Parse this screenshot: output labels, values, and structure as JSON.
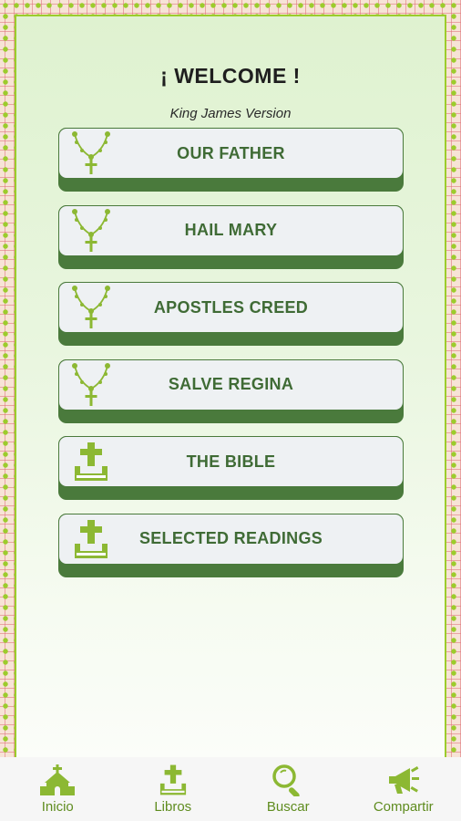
{
  "header": {
    "title": "¡ WELCOME !",
    "subtitle": "King James Version"
  },
  "menu": [
    {
      "label": "OUR FATHER",
      "icon": "rosary-icon"
    },
    {
      "label": "HAIL MARY",
      "icon": "rosary-icon"
    },
    {
      "label": "APOSTLES CREED",
      "icon": "rosary-icon"
    },
    {
      "label": "SALVE REGINA",
      "icon": "rosary-icon"
    },
    {
      "label": "THE BIBLE",
      "icon": "bible-cross-icon"
    },
    {
      "label": "SELECTED READINGS",
      "icon": "bible-cross-icon"
    }
  ],
  "bottom_nav": [
    {
      "label": "Inicio",
      "icon": "church-icon"
    },
    {
      "label": "Libros",
      "icon": "bible-cross-icon"
    },
    {
      "label": "Buscar",
      "icon": "search-icon"
    },
    {
      "label": "Compartir",
      "icon": "megaphone-icon"
    }
  ],
  "colors": {
    "accent": "#9ccc2c",
    "button_shadow": "#4a7a3c",
    "button_text": "#3f6b35",
    "nav_text": "#5f8c1f"
  }
}
